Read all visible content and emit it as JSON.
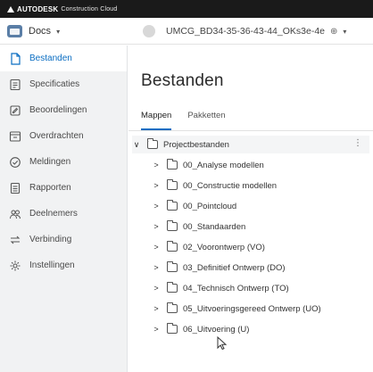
{
  "brand": {
    "name": "AUTODESK",
    "product": "Construction Cloud"
  },
  "module": {
    "label": "Docs",
    "caret": "▾",
    "icon": "docs-module-icon"
  },
  "project": {
    "name": "UMCG_BD34-35-36-43-44_OKs3e-4e",
    "globe_icon": "⊕",
    "caret": "▾"
  },
  "sidebar": {
    "items": [
      {
        "label": "Bestanden",
        "icon": "files-icon",
        "active": true
      },
      {
        "label": "Specificaties",
        "icon": "specifications-icon"
      },
      {
        "label": "Beoordelingen",
        "icon": "reviews-icon"
      },
      {
        "label": "Overdrachten",
        "icon": "transmittals-icon"
      },
      {
        "label": "Meldingen",
        "icon": "issues-icon"
      },
      {
        "label": "Rapporten",
        "icon": "reports-icon"
      },
      {
        "label": "Deelnemers",
        "icon": "members-icon"
      },
      {
        "label": "Verbinding",
        "icon": "bridge-icon"
      },
      {
        "label": "Instellingen",
        "icon": "settings-icon"
      }
    ]
  },
  "main": {
    "title": "Bestanden",
    "tabs": [
      {
        "label": "Mappen",
        "active": true
      },
      {
        "label": "Pakketten",
        "active": false
      }
    ],
    "tree": {
      "root": {
        "label": "Projectbestanden",
        "chevron": "∨",
        "menu": "⋮"
      },
      "children": [
        {
          "label": "00_Analyse modellen"
        },
        {
          "label": "00_Constructie modellen"
        },
        {
          "label": "00_Pointcloud"
        },
        {
          "label": "00_Standaarden"
        },
        {
          "label": "02_Voorontwerp (VO)"
        },
        {
          "label": "03_Definitief Ontwerp (DO)"
        },
        {
          "label": "04_Technisch Ontwerp (TO)"
        },
        {
          "label": "05_Uitvoeringsgereed Ontwerp (UO)"
        },
        {
          "label": "06_Uitvoering (U)"
        }
      ],
      "child_chevron": ">"
    }
  },
  "colors": {
    "accent": "#0a6dc2",
    "sidebar_bg": "#f1f2f3",
    "brandbar_bg": "#1a1a1a"
  }
}
